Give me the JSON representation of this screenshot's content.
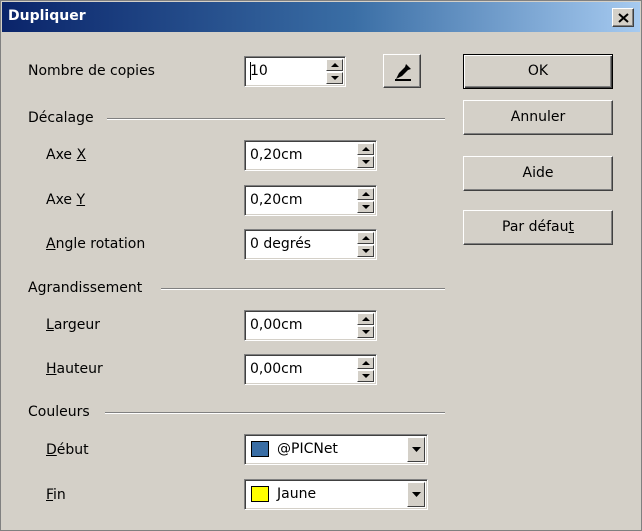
{
  "window": {
    "title": "Dupliquer",
    "close_glyph": "×"
  },
  "copies": {
    "label": "Nombre de copies",
    "value": "10"
  },
  "offset": {
    "group_label": "Décalage",
    "axis_x": {
      "label_pre": "Axe ",
      "label_key": "X",
      "value": "0,20cm"
    },
    "axis_y": {
      "label_pre": "Axe ",
      "label_key": "Y",
      "value": "0,20cm"
    },
    "angle": {
      "label_key": "A",
      "label_post": "ngle rotation",
      "value": "0 degrés"
    }
  },
  "enlargement": {
    "group_label": "Agrandissement",
    "width": {
      "label_key": "L",
      "label_post": "argeur",
      "value": "0,00cm"
    },
    "height": {
      "label_key": "H",
      "label_post": "auteur",
      "value": "0,00cm"
    }
  },
  "colors": {
    "group_label": "Couleurs",
    "start": {
      "label_key": "D",
      "label_post": "ébut",
      "value": "@PICNet",
      "swatch": "#3a6ea5"
    },
    "end": {
      "label_key": "F",
      "label_post": "in",
      "value": "Jaune",
      "swatch": "#ffff00"
    }
  },
  "buttons": {
    "ok": "OK",
    "cancel": "Annuler",
    "help": "Aide",
    "default_pre": "Par défau",
    "default_key": "t"
  },
  "icons": {
    "picker": "eyedropper-icon",
    "close": "close-icon",
    "spin_up": "arrow-up-icon",
    "spin_down": "arrow-down-icon",
    "dropdown": "chevron-down-icon"
  }
}
